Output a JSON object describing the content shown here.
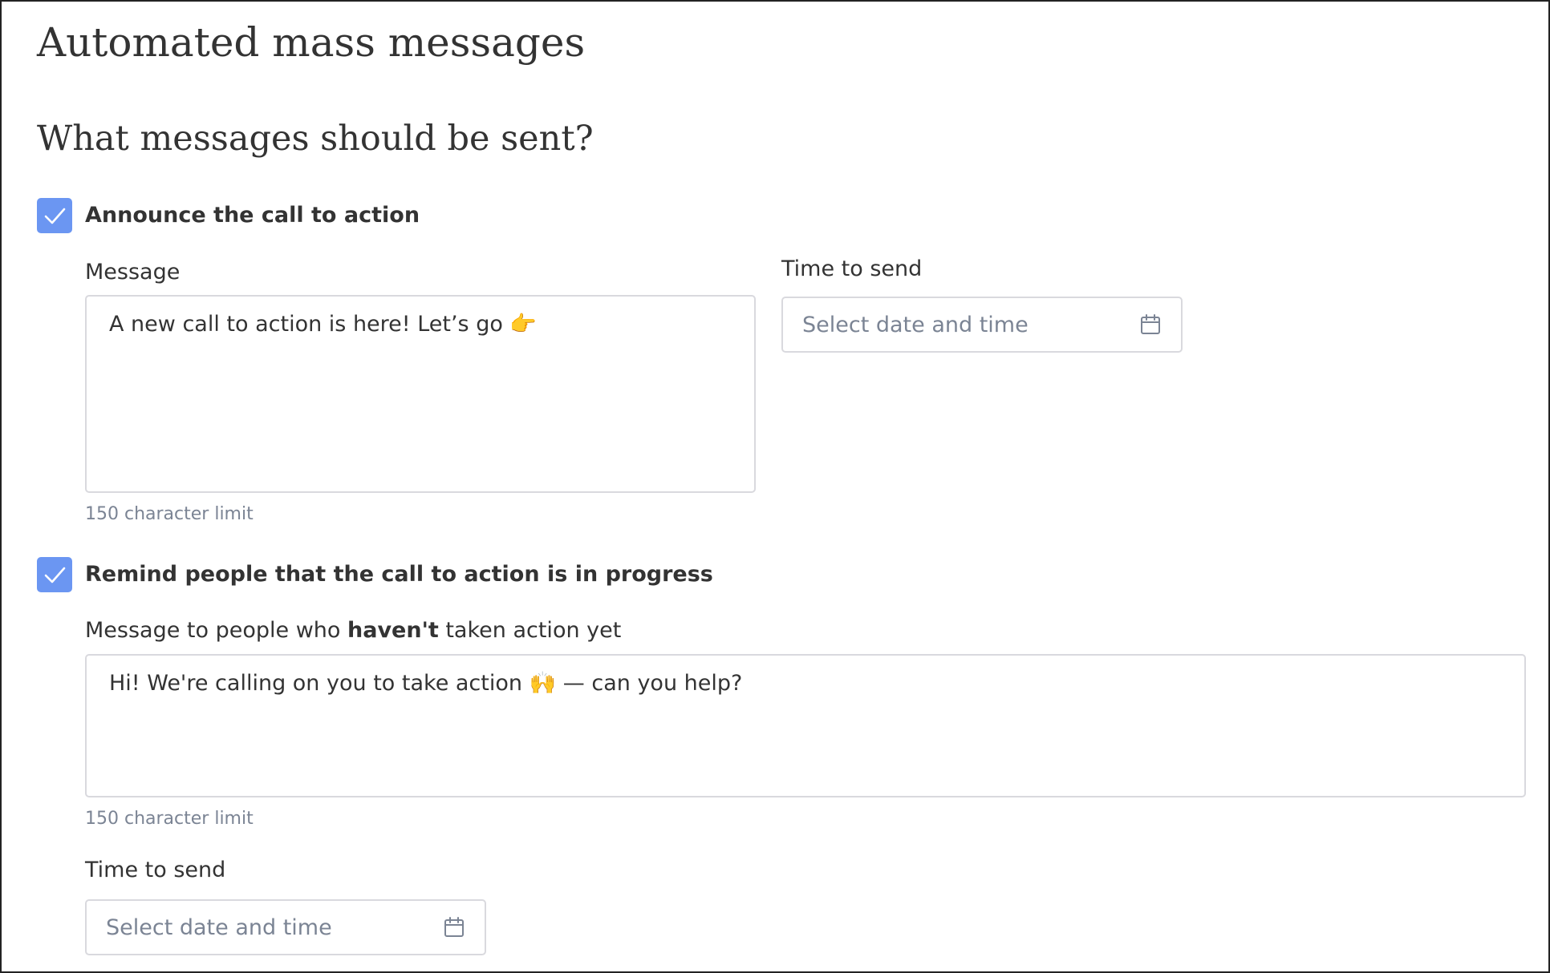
{
  "page": {
    "title": "Automated mass messages",
    "section_title": "What messages should be sent?"
  },
  "announce": {
    "checked": true,
    "label": "Announce the call to action",
    "message_label": "Message",
    "message_value": "A new call to action is here! Let’s go 👉",
    "hint": "150 character limit",
    "time_label": "Time to send",
    "time_placeholder": "Select date and time"
  },
  "remind": {
    "checked": true,
    "label": "Remind people that the call to action is in progress",
    "message_label_prefix": "Message to people who ",
    "message_label_bold": "haven't",
    "message_label_suffix": " taken action yet",
    "message_value": "Hi! We're calling on you to take action 🙌 — can you help?",
    "hint": "150 character limit",
    "time_label": "Time to send",
    "time_placeholder": "Select date and time"
  },
  "colors": {
    "accent": "#6b96f2",
    "border": "#d9d9de",
    "hint": "#7b8494",
    "text": "#333333"
  },
  "icons": {
    "checkbox": "check-icon",
    "datepicker": "calendar-icon"
  }
}
